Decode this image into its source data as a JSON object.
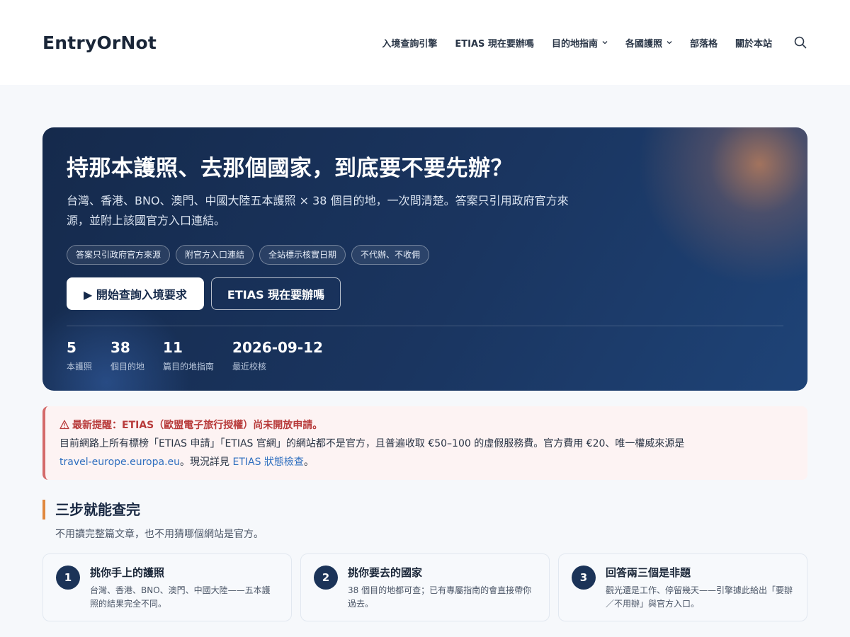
{
  "header": {
    "logo": "EntryOrNot",
    "nav": [
      {
        "label": "入境查詢引擎"
      },
      {
        "label": "ETIAS 現在要辦嗎"
      },
      {
        "label": "目的地指南"
      },
      {
        "label": "各國護照"
      },
      {
        "label": "部落格"
      },
      {
        "label": "關於本站"
      }
    ],
    "search_icon": "search-icon"
  },
  "hero": {
    "title": "持那本護照、去那個國家，到底要不要先辦？",
    "subtitle": "台灣、香港、BNO、澳門、中國大陸五本護照 × 38 個目的地，一次問清楚。答案只引用政府官方來源，並附上該國官方入口連結。",
    "chips": [
      "答案只引政府官方來源",
      "附官方入口連結",
      "全站標示核實日期",
      "不代辦、不收佣"
    ],
    "primary_cta": "▶ 開始查詢入境要求",
    "secondary_cta": "ETIAS 現在要辦嗎",
    "stats": [
      {
        "value": "5",
        "label": "本護照"
      },
      {
        "value": "38",
        "label": "個目的地"
      },
      {
        "value": "11",
        "label": "篇目的地指南"
      },
      {
        "value": "2026-09-12",
        "label": "最近校核"
      }
    ]
  },
  "alert": {
    "icon": "warning-icon",
    "title": "最新提醒：ETIAS（歐盟電子旅行授權）尚未開放申請。",
    "body_1": "目前網路上所有標榜「ETIAS 申請」「ETIAS 官網」的網站都不是官方，且普遍收取 €50–100 的虛假服務費。官方費用 €20、唯一權威來源是",
    "link_1": "travel-europe.europa.eu",
    "body_2": "。現況詳見",
    "link_2": "ETIAS 狀態檢查",
    "body_3": "。"
  },
  "steps": {
    "title": "三步就能查完",
    "subtitle": "不用讀完整篇文章，也不用猜哪個網站是官方。",
    "cards": [
      {
        "num": "1",
        "title": "挑你手上的護照",
        "desc": "台灣、香港、BNO、澳門、中國大陸——五本護照的結果完全不同。"
      },
      {
        "num": "2",
        "title": "挑你要去的國家",
        "desc": "38 個目的地都可查；已有專屬指南的會直接帶你過去。"
      },
      {
        "num": "3",
        "title": "回答兩三個是非題",
        "desc": "觀光還是工作、停留幾天——引擎據此給出「要辦／不用辦」與官方入口。"
      }
    ]
  },
  "colors": {
    "hero_bg": "#1a3560",
    "accent_orange": "#e0873e",
    "alert_red": "#b83b3b",
    "link_blue": "#2f6fbf"
  }
}
